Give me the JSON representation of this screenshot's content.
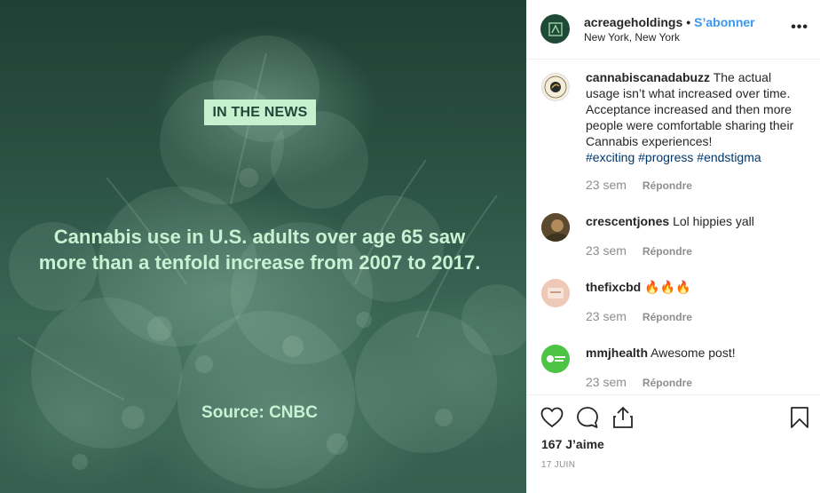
{
  "post": {
    "badge": "IN THE NEWS",
    "headline": "Cannabis use in U.S. adults over age 65 saw more than a tenfold increase from 2007 to 2017.",
    "source": "Source: CNBC"
  },
  "header": {
    "username": "acreageholdings",
    "separator": "•",
    "follow_label": "S’abonner",
    "location": "New York, New York",
    "more": "•••"
  },
  "comments": [
    {
      "username": "cannabiscanadabuzz",
      "text": "The actual usage isn’t what increased over time. Acceptance increased and then more people were comfortable sharing their Cannabis experiences!",
      "hashtags": "#exciting #progress #endstigma",
      "time": "23 sem",
      "reply": "Répondre"
    },
    {
      "username": "crescentjones",
      "text": "Lol hippies yall",
      "time": "23 sem",
      "reply": "Répondre"
    },
    {
      "username": "thefixcbd",
      "text": "🔥🔥🔥",
      "time": "23 sem",
      "reply": "Répondre"
    },
    {
      "username": "mmjhealth",
      "text": "Awesome post!",
      "time": "23 sem",
      "reply": "Répondre"
    }
  ],
  "actions": {
    "likes": "167 J’aime",
    "date": "17 JUIN"
  },
  "colors": {
    "accent": "#3897f0",
    "badge_bg": "#c6f1cf",
    "text_light": "#c8f2d2",
    "image_bg": "#2b5244"
  }
}
